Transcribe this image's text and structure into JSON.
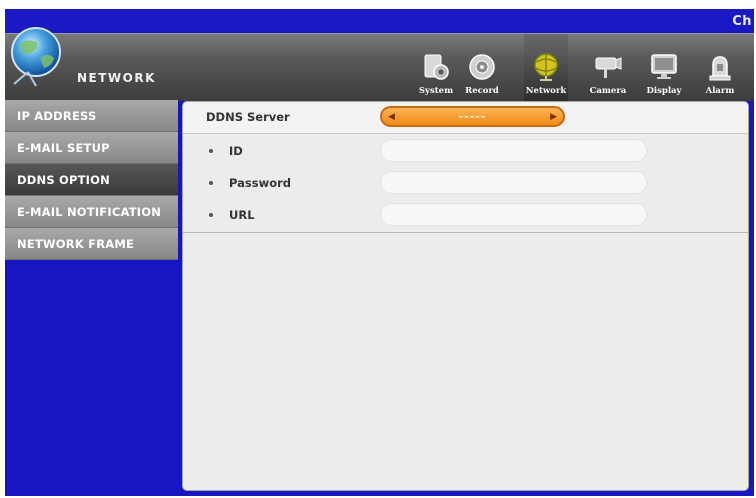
{
  "header": {
    "corner_text": "Ch",
    "section_title": "NETWORK"
  },
  "tabs": [
    {
      "label": "System",
      "icon": "system-icon",
      "active": false
    },
    {
      "label": "Record",
      "icon": "record-icon",
      "active": false
    },
    {
      "label": "Network",
      "icon": "network-icon",
      "active": true
    },
    {
      "label": "Camera",
      "icon": "camera-icon",
      "active": false
    },
    {
      "label": "Display",
      "icon": "display-icon",
      "active": false
    },
    {
      "label": "Alarm",
      "icon": "alarm-icon",
      "active": false
    }
  ],
  "sidebar": {
    "items": [
      {
        "label": "IP ADDRESS",
        "active": false
      },
      {
        "label": "E-MAIL SETUP",
        "active": false
      },
      {
        "label": "DDNS OPTION",
        "active": true
      },
      {
        "label": "E-MAIL NOTIFICATION",
        "active": false
      },
      {
        "label": "NETWORK FRAME",
        "active": false
      }
    ]
  },
  "panel": {
    "ddns_server": {
      "label": "DDNS Server",
      "value": "-----"
    },
    "fields": [
      {
        "label": "ID",
        "value": ""
      },
      {
        "label": "Password",
        "value": ""
      },
      {
        "label": "URL",
        "value": ""
      }
    ]
  },
  "colors": {
    "frame_blue": "#1717c2",
    "accent_orange": "#ef8a18"
  }
}
